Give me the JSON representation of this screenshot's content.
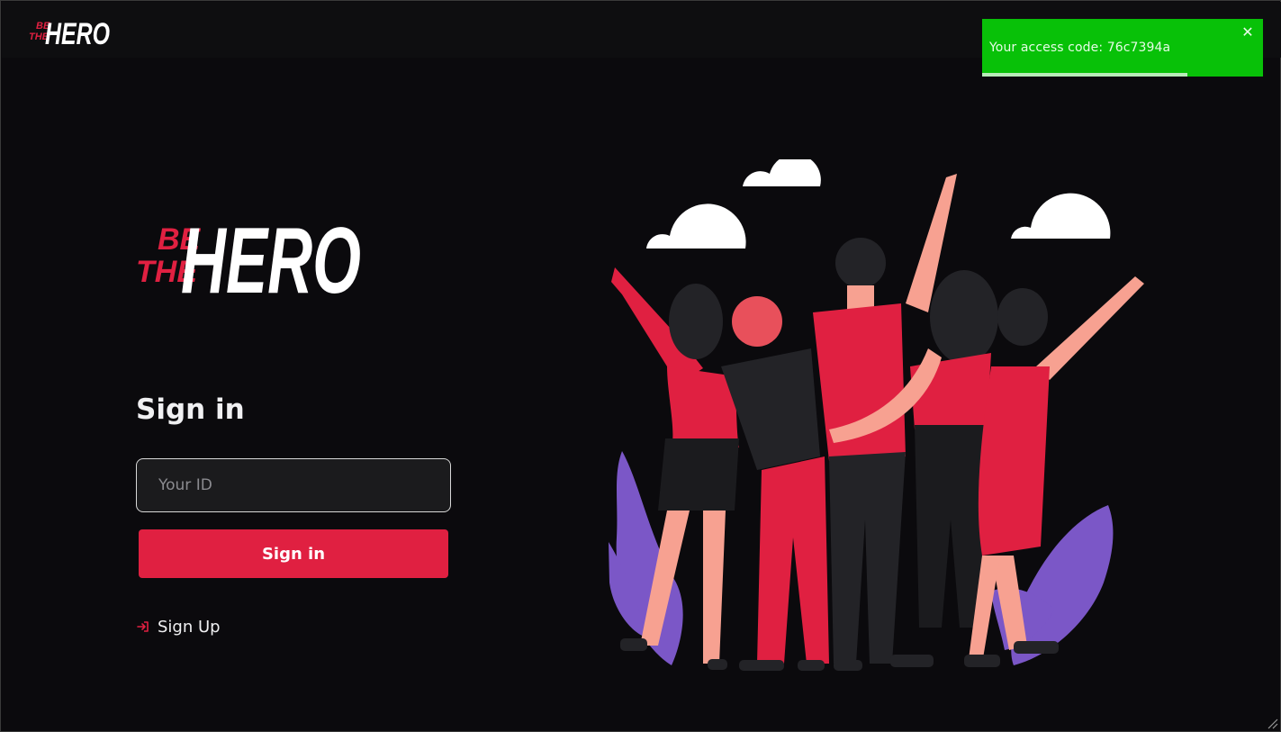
{
  "header": {
    "logo": {
      "line1": "BE",
      "line2": "THE",
      "word": "HERO"
    }
  },
  "toast": {
    "message": "Your access code: 76c7394a",
    "close_icon": "close-icon",
    "progress": 0.73,
    "color": "#08c108"
  },
  "brand": {
    "logo": {
      "line1": "BE",
      "line2": "THE",
      "word": "HERO"
    },
    "accent": "#e02041"
  },
  "login": {
    "title": "Sign in",
    "id_placeholder": "Your ID",
    "id_value": "",
    "submit_label": "Sign in",
    "signup_label": "Sign Up",
    "signup_icon": "log-in-icon"
  },
  "illustration": {
    "icon": "group-of-friends-illustration"
  }
}
